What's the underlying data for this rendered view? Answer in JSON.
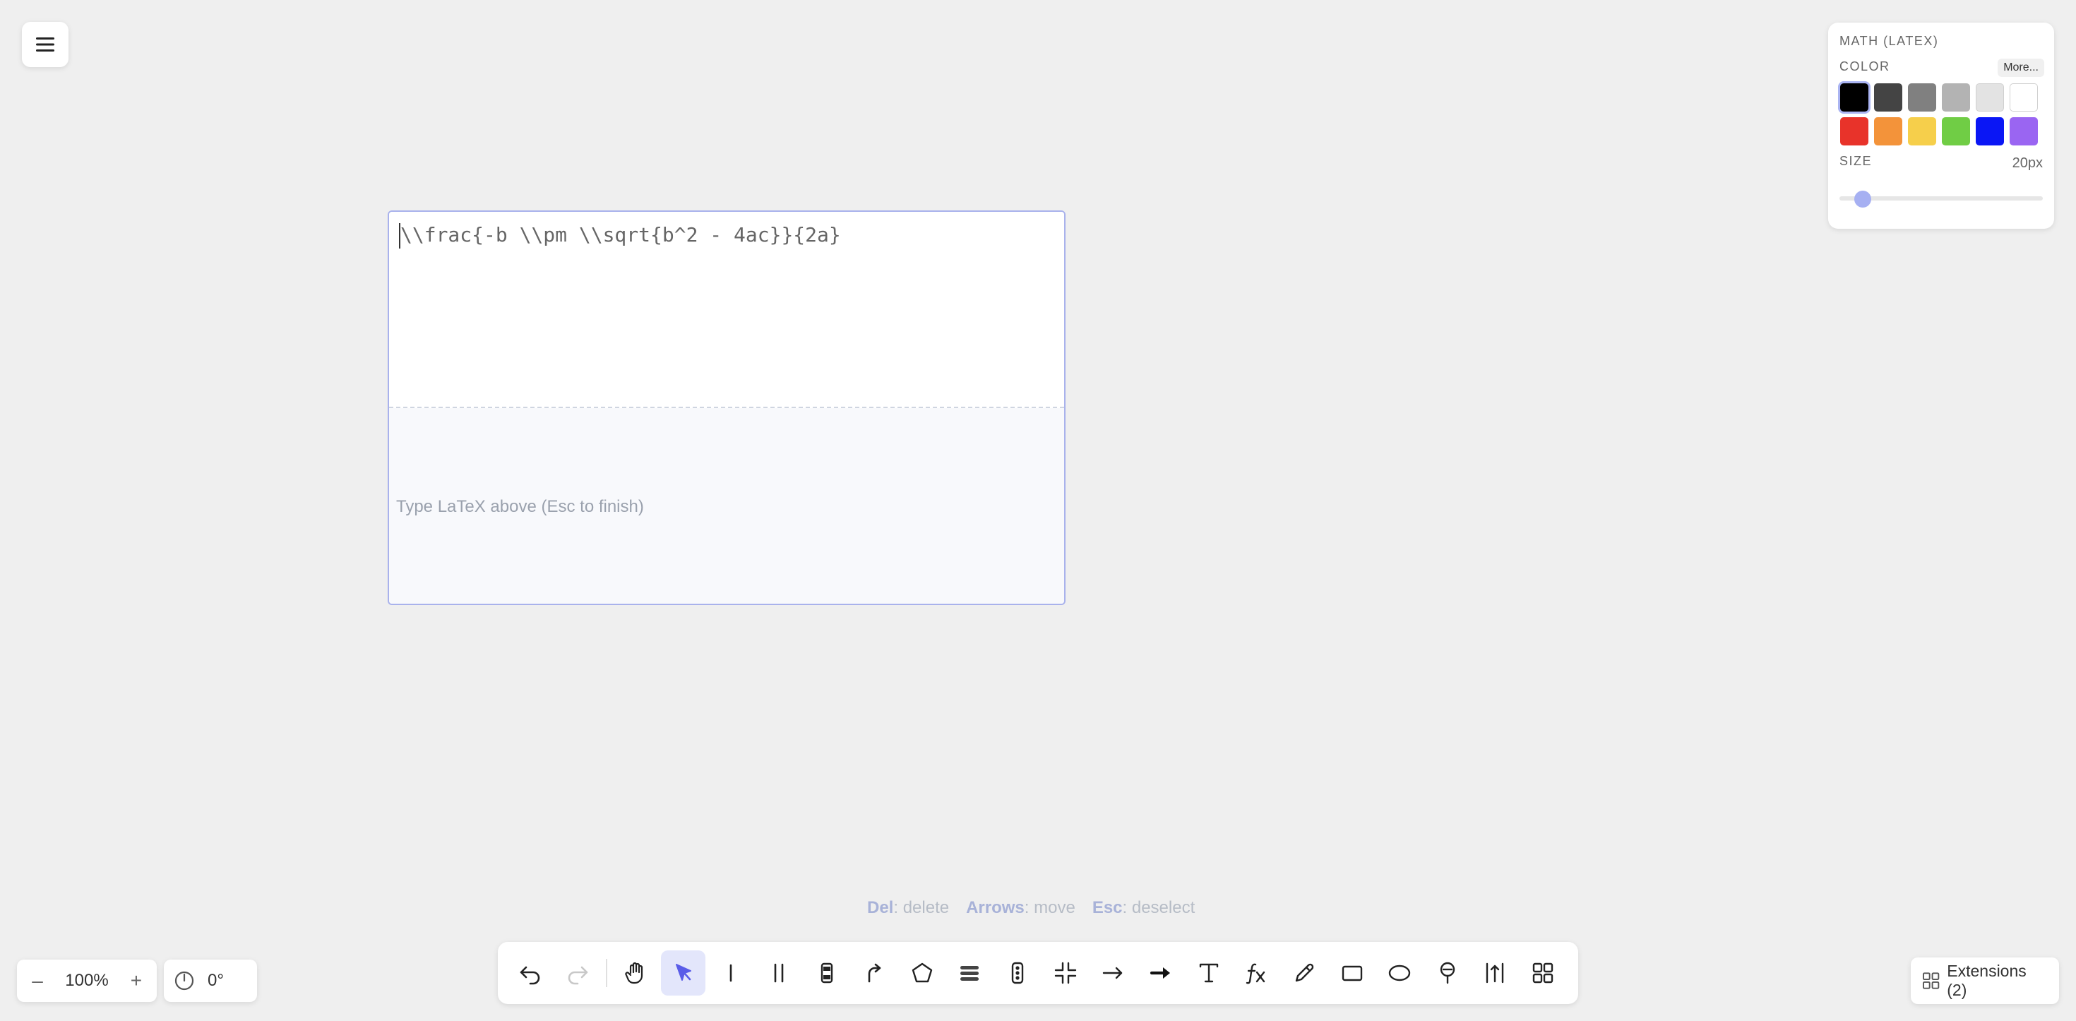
{
  "menu": {
    "icon": "hamburger-icon"
  },
  "editor": {
    "latex_value": "\\\\frac{-b \\\\pm \\\\sqrt{b^2 - 4ac}}{2a}",
    "preview_hint": "Type LaTeX above (Esc to finish)"
  },
  "properties": {
    "title": "MATH (LATEX)",
    "color_label": "COLOR",
    "more_label": "More...",
    "size_label": "SIZE",
    "size_value": "20px",
    "size_level": 0.1,
    "selected_color": "#000000",
    "colors": [
      "#000000",
      "#444444",
      "#808080",
      "#b3b3b3",
      "#e3e3e3",
      "#ffffff",
      "#e8332a",
      "#f3933a",
      "#f6cf4b",
      "#70cd45",
      "#0a16f5",
      "#9a65f2"
    ]
  },
  "hints": [
    {
      "key": "Del",
      "action": ": delete"
    },
    {
      "key": "Arrows",
      "action": ": move"
    },
    {
      "key": "Esc",
      "action": ": deselect"
    }
  ],
  "zoom": {
    "minus": "–",
    "value": "100%",
    "plus": "+"
  },
  "rotation": {
    "value": "0°"
  },
  "toolbar": {
    "tools": [
      "undo",
      "redo",
      "hand",
      "select",
      "line",
      "double-line",
      "component",
      "curve-arrow",
      "polygon",
      "stack",
      "traffic-light",
      "compress",
      "arrow",
      "bold-arrow",
      "text",
      "function",
      "pencil",
      "rectangle",
      "ellipse",
      "marker",
      "measure",
      "grid"
    ],
    "active_tool": "select"
  },
  "extensions": {
    "label": "Extensions (2)"
  },
  "accent_color": "#5a5de8"
}
